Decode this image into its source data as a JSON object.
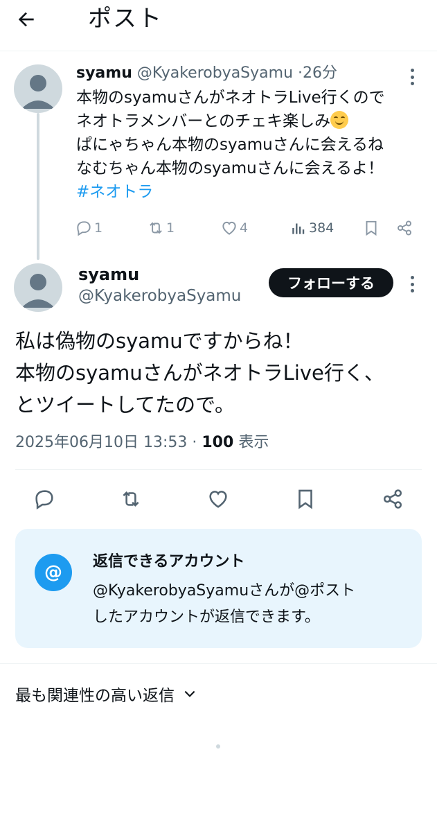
{
  "header": {
    "title": "ポスト",
    "back_icon": "arrow-left-icon"
  },
  "parent_post": {
    "name": "syamu",
    "handle": "@KyakerobyaSyamu",
    "separator": "·",
    "time": "26分",
    "lines": [
      "本物のsyamuさんがネオトラLive行くので",
      "ネオトラメンバーとのチェキ楽しみ",
      "ぱにゃちゃん本物のsyamuさんに会えるね",
      "なむちゃん本物のsyamuさんに会えるよ！"
    ],
    "emoji": "smiling-face-emoji",
    "hashtag": "#ネオトラ",
    "replies": "1",
    "reposts": "1",
    "likes": "4",
    "views": "384"
  },
  "main_post": {
    "name": "syamu",
    "handle": "@KyakerobyaSyamu",
    "follow_label": "フォローする",
    "lines": [
      "私は偽物のsyamuですからね！",
      "本物のsyamuさんがネオトラLive行く、",
      "とツイートしてたので。"
    ],
    "datetime": "2025年06月10日 13:53",
    "separator": "·",
    "views_count": "100",
    "views_label": "表示"
  },
  "reply_settings": {
    "badge": "@",
    "title": "返信できるアカウント",
    "lines": [
      "@KyakerobyaSyamuさんが@ポスト",
      "したアカウントが返信できます。"
    ]
  },
  "replies_sort": {
    "label": "最も関連性の高い返信"
  },
  "colors": {
    "accent": "#1d9bf0",
    "text": "#0f1419",
    "muted": "#536471",
    "card_bg": "#e8f5fd"
  }
}
